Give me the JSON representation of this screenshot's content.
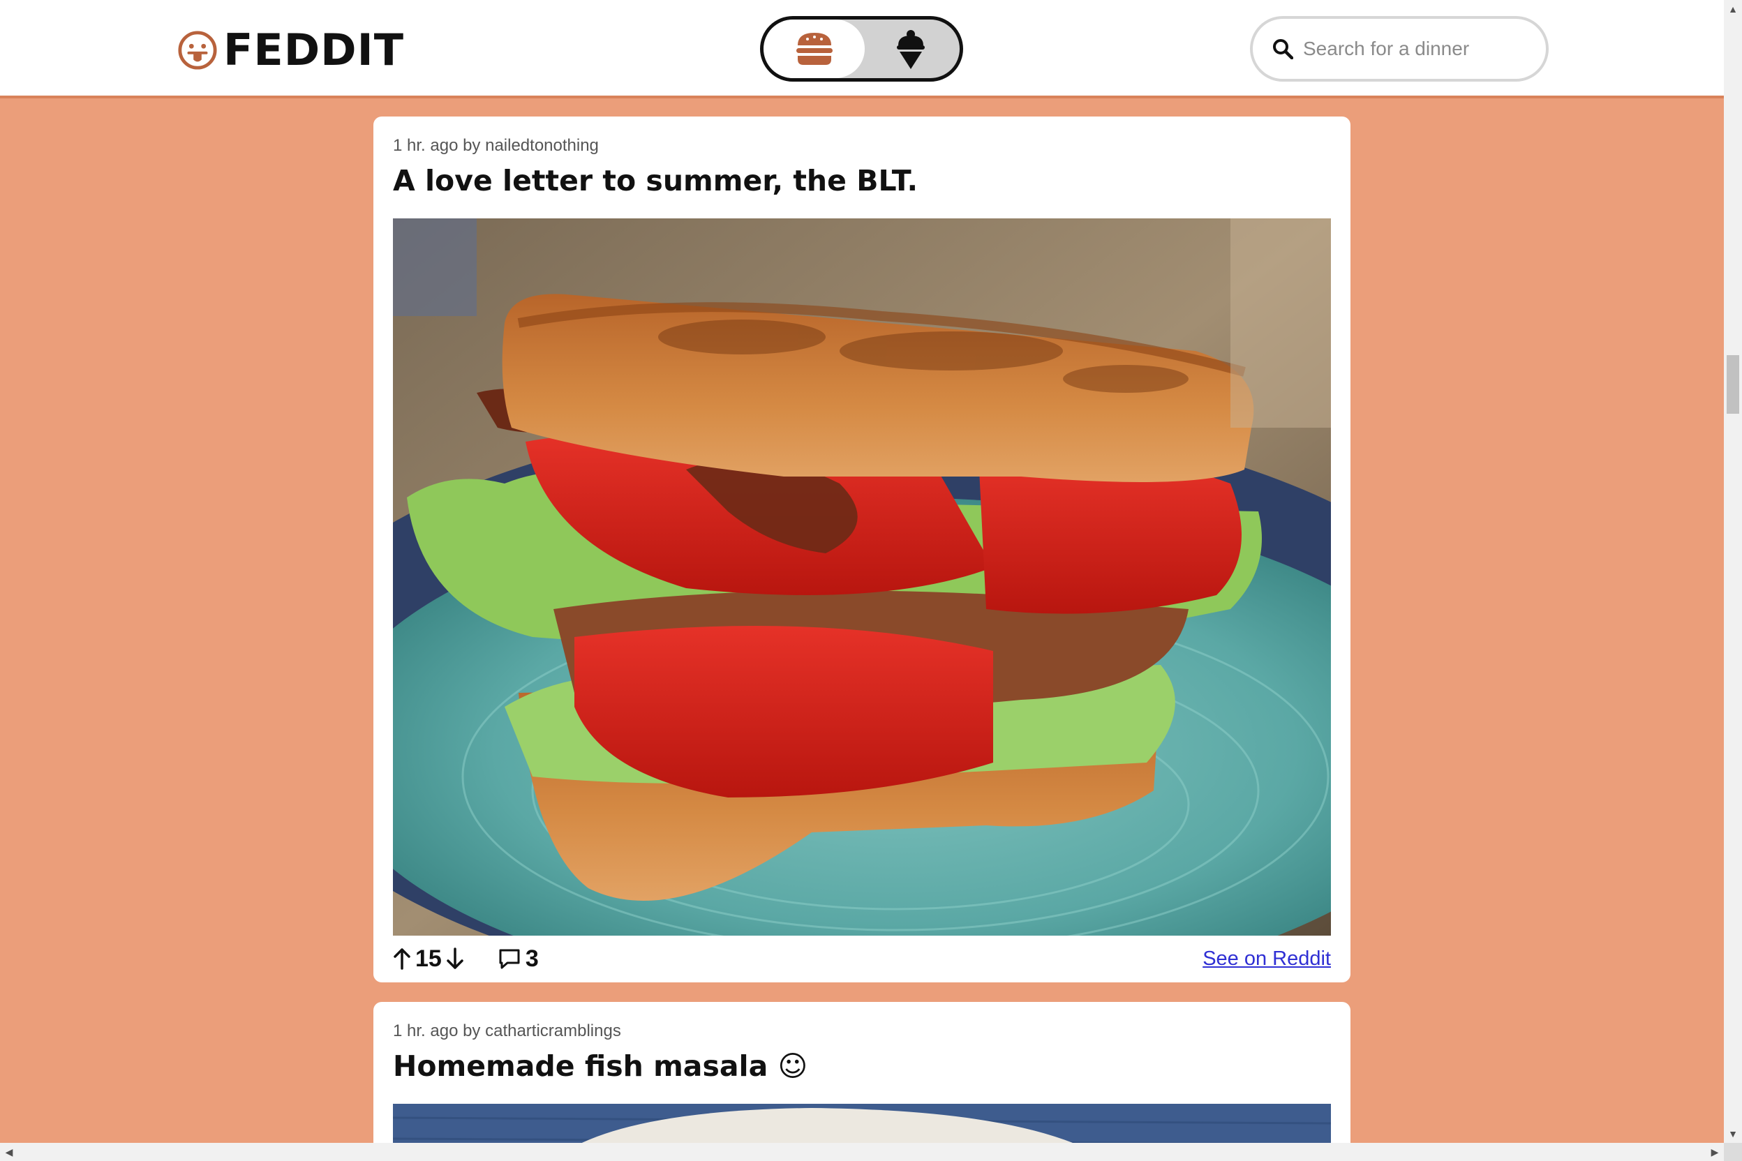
{
  "header": {
    "logo_text": "FEDDIT",
    "toggle": {
      "left_icon": "burger-icon",
      "right_icon": "ice-cream-icon",
      "selected": "left"
    },
    "search": {
      "placeholder": "Search for a dinner",
      "value": ""
    }
  },
  "posts": [
    {
      "meta": "1 hr. ago by nailedtonothing",
      "title": "A love letter to summer, the BLT.",
      "image": "blt-sandwich-photo",
      "score": "15",
      "comments": "3",
      "link_label": "See on Reddit"
    },
    {
      "meta": "1 hr. ago by catharticramblings",
      "title": "Homemade fish masala ☺",
      "image": "fish-masala-photo"
    }
  ],
  "colors": {
    "page_background": "#EB9E7A",
    "header_border": "#D9825A",
    "accent_brown": "#B8623C",
    "link": "#2F2FD4"
  }
}
